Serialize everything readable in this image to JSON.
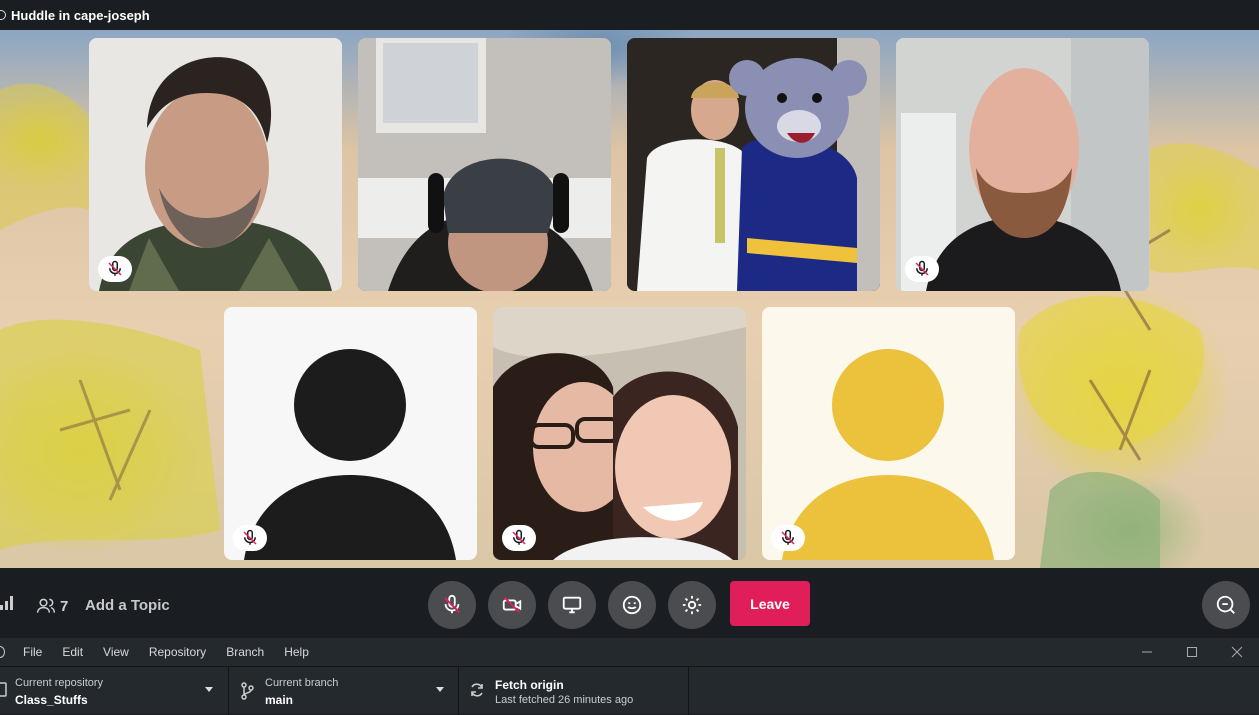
{
  "title": "Huddle in cape-joseph",
  "participants": [
    {
      "muted": true
    },
    {
      "muted": false
    },
    {
      "muted": false
    },
    {
      "muted": true
    },
    {
      "muted": true,
      "avatar": "placeholder",
      "color": "#1d1c1d"
    },
    {
      "muted": true
    },
    {
      "muted": true,
      "avatar": "placeholder",
      "color": "#ecc23c"
    }
  ],
  "callbar": {
    "participant_count": "7",
    "add_topic": "Add a Topic",
    "leave_label": "Leave",
    "leave_color": "#e01e5a"
  },
  "menu": {
    "items": [
      "File",
      "Edit",
      "View",
      "Repository",
      "Branch",
      "Help"
    ]
  },
  "toolbar": {
    "repo_label": "Current repository",
    "repo_value": "Class_Stuffs",
    "branch_label": "Current branch",
    "branch_value": "main",
    "fetch_label": "Fetch origin",
    "fetch_sub": "Last fetched 26 minutes ago"
  }
}
